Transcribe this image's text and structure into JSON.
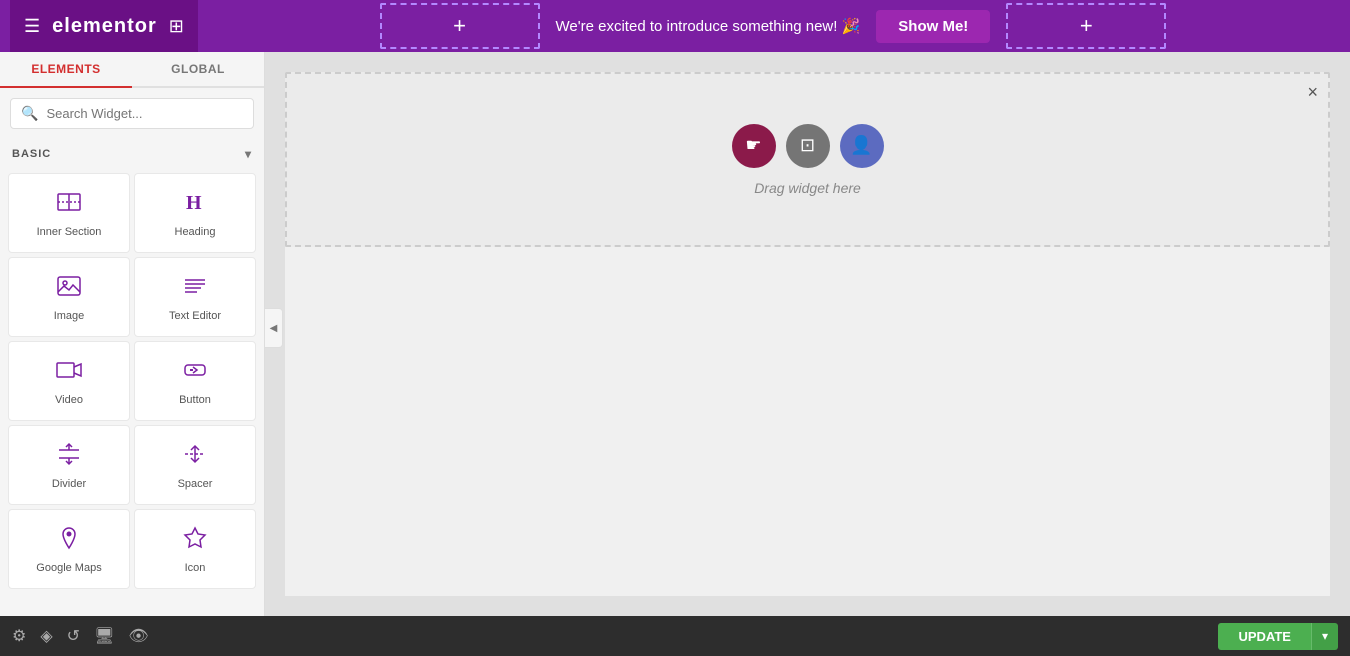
{
  "topbar": {
    "logo": "elementor",
    "announcement": "We're excited to introduce something new! 🎉",
    "show_me_label": "Show Me!",
    "add_section_plus": "+"
  },
  "sidebar": {
    "tab_elements": "ELEMENTS",
    "tab_global": "GLOBAL",
    "search_placeholder": "Search Widget...",
    "section_basic": "BASIC",
    "widgets": [
      {
        "id": "inner-section",
        "label": "Inner Section",
        "icon": "inner-section-icon"
      },
      {
        "id": "heading",
        "label": "Heading",
        "icon": "heading-icon"
      },
      {
        "id": "image",
        "label": "Image",
        "icon": "image-icon"
      },
      {
        "id": "text-editor",
        "label": "Text Editor",
        "icon": "text-editor-icon"
      },
      {
        "id": "video",
        "label": "Video",
        "icon": "video-icon"
      },
      {
        "id": "button",
        "label": "Button",
        "icon": "button-icon"
      },
      {
        "id": "divider",
        "label": "Divider",
        "icon": "divider-icon"
      },
      {
        "id": "spacer",
        "label": "Spacer",
        "icon": "spacer-icon"
      },
      {
        "id": "google-maps",
        "label": "Google Maps",
        "icon": "maps-icon"
      },
      {
        "id": "icon",
        "label": "Icon",
        "icon": "icon-icon"
      }
    ]
  },
  "canvas": {
    "drag_widget_text": "Drag widget here",
    "close_btn": "×"
  },
  "bottombar": {
    "update_label": "UPDATE"
  }
}
